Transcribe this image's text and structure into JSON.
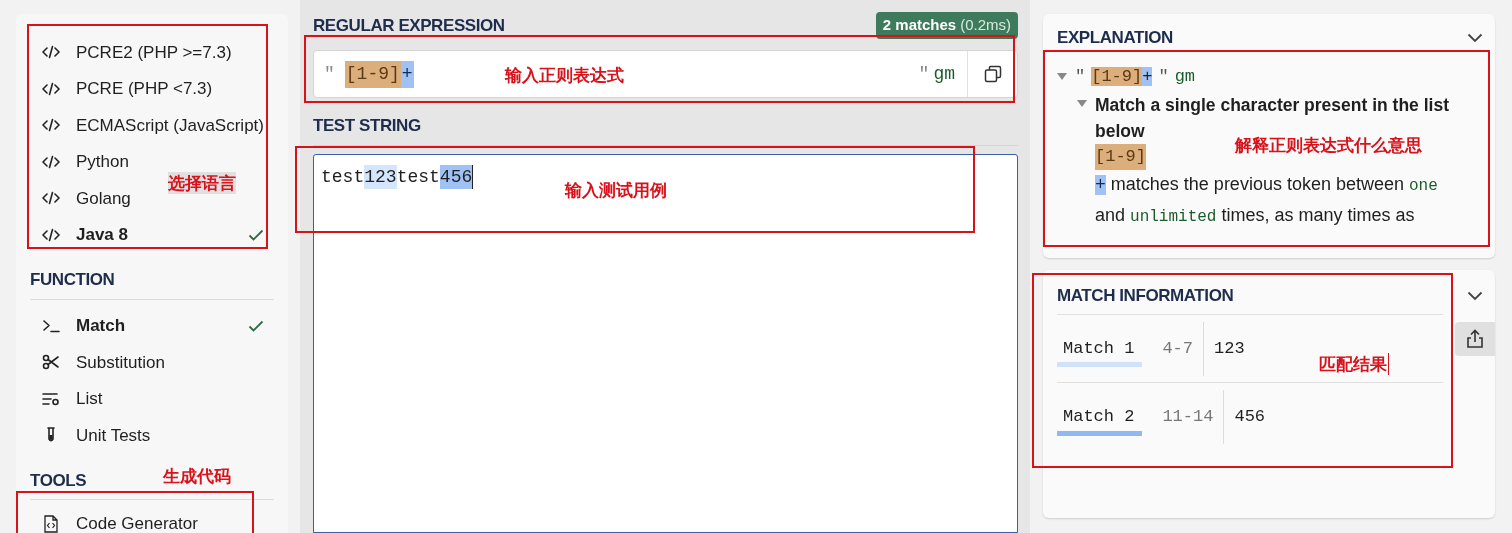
{
  "sidebar": {
    "flavors": [
      {
        "label": "PCRE2 (PHP >=7.3)",
        "selected": false
      },
      {
        "label": "PCRE (PHP <7.3)",
        "selected": false
      },
      {
        "label": "ECMAScript (JavaScript)",
        "selected": false
      },
      {
        "label": "Python",
        "selected": false
      },
      {
        "label": "Golang",
        "selected": false
      },
      {
        "label": "Java 8",
        "selected": true
      }
    ],
    "function_heading": "FUNCTION",
    "functions": [
      {
        "label": "Match",
        "kind": "match",
        "selected": true
      },
      {
        "label": "Substitution",
        "kind": "substitution",
        "selected": false
      },
      {
        "label": "List",
        "kind": "list",
        "selected": false
      },
      {
        "label": "Unit Tests",
        "kind": "tests",
        "selected": false
      }
    ],
    "tools_heading": "TOOLS",
    "tools": [
      {
        "label": "Code Generator"
      }
    ]
  },
  "regex": {
    "heading": "REGULAR EXPRESSION",
    "badge_count": "2 matches",
    "badge_time": "(0.2ms)",
    "open_quote": "\"",
    "class_token": "[1-9]",
    "quantifier": "+",
    "close_quote": "\"",
    "flags": "gm"
  },
  "test_string": {
    "heading": "TEST STRING",
    "segments": [
      {
        "text": "test",
        "kind": "plain"
      },
      {
        "text": "123",
        "kind": "match1"
      },
      {
        "text": "test",
        "kind": "plain"
      },
      {
        "text": "456",
        "kind": "match2"
      }
    ]
  },
  "explanation": {
    "heading": "EXPLANATION",
    "open_quote": "\"",
    "class_token": "[1-9]",
    "quantifier": "+",
    "close_quote": "\"",
    "flags": "gm",
    "node_title": "Match a single character present in the list below",
    "node_token": "[1-9]",
    "quantifier_token": "+",
    "quantifier_text": [
      {
        "text": "matches the previous token between ",
        "kind": "plain"
      },
      {
        "text": "one",
        "kind": "code"
      },
      {
        "text": " and ",
        "kind": "plain"
      },
      {
        "text": "unlimited",
        "kind": "code"
      },
      {
        "text": " times, as many times as",
        "kind": "plain"
      }
    ]
  },
  "match_information": {
    "heading": "MATCH INFORMATION",
    "matches": [
      {
        "label": "Match 1",
        "range": "4-7",
        "value": "123",
        "kind": "match1"
      },
      {
        "label": "Match 2",
        "range": "11-14",
        "value": "456",
        "kind": "match2"
      }
    ]
  },
  "annotations": {
    "flavors": "选择语言",
    "regex": "输入正则表达式",
    "test": "输入测试用例",
    "explanation": "解释正则表达式什么意思",
    "matches": "匹配结果",
    "tools": "生成代码"
  }
}
